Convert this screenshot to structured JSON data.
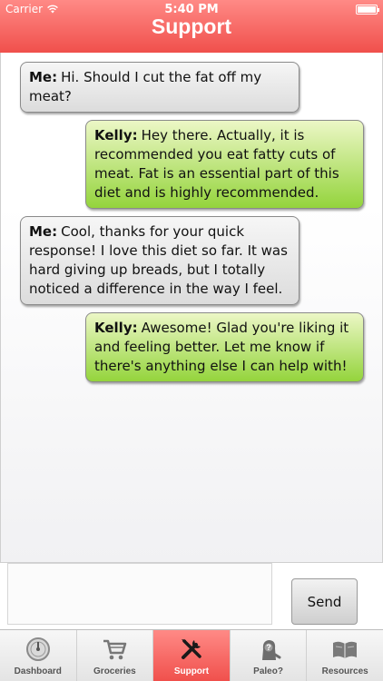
{
  "status_bar": {
    "carrier": "Carrier",
    "time": "5:40 PM"
  },
  "header": {
    "title": "Support"
  },
  "messages": [
    {
      "sender": "Me:",
      "text": "Hi. Should I cut the fat off my meat?",
      "from": "me"
    },
    {
      "sender": "Kelly:",
      "text": "Hey there. Actually, it is recommended you eat fatty cuts of meat. Fat is an essential part of this diet and is highly recommended.",
      "from": "kelly"
    },
    {
      "sender": "Me:",
      "text": "Cool, thanks for your quick response! I love this diet so far. It was hard giving up breads, but I totally noticed a difference in the way I feel.",
      "from": "me"
    },
    {
      "sender": "Kelly:",
      "text": "Awesome! Glad you're liking it and feeling better. Let me know if there's anything else I can help with!",
      "from": "kelly"
    }
  ],
  "composer": {
    "input_value": "",
    "send_label": "Send"
  },
  "tabs": [
    {
      "label": "Dashboard",
      "icon": "gauge-icon",
      "active": false
    },
    {
      "label": "Groceries",
      "icon": "cart-icon",
      "active": false
    },
    {
      "label": "Support",
      "icon": "tools-icon",
      "active": true
    },
    {
      "label": "Paleo?",
      "icon": "caveman-icon",
      "active": false
    },
    {
      "label": "Resources",
      "icon": "book-icon",
      "active": false
    }
  ],
  "colors": {
    "header": "#f0504c",
    "kelly_bubble": "#94d43c",
    "me_bubble": "#dcdcdc"
  }
}
